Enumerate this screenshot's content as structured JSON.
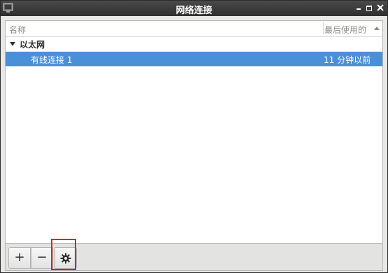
{
  "window": {
    "title": "网络连接"
  },
  "list": {
    "columns": {
      "name": "名称",
      "last_used": "最后使用的"
    },
    "groups": [
      {
        "label": "以太网",
        "connections": [
          {
            "name": "有线连接 1",
            "last_used": "11 分钟以前",
            "selected": true
          }
        ]
      }
    ]
  },
  "toolbar": {
    "add_label": "+",
    "remove_label": "−",
    "settings_icon": "gear-icon"
  },
  "colors": {
    "selection": "#4a90d9",
    "highlight_box": "#e02020",
    "titlebar": "#2e2e2e"
  }
}
